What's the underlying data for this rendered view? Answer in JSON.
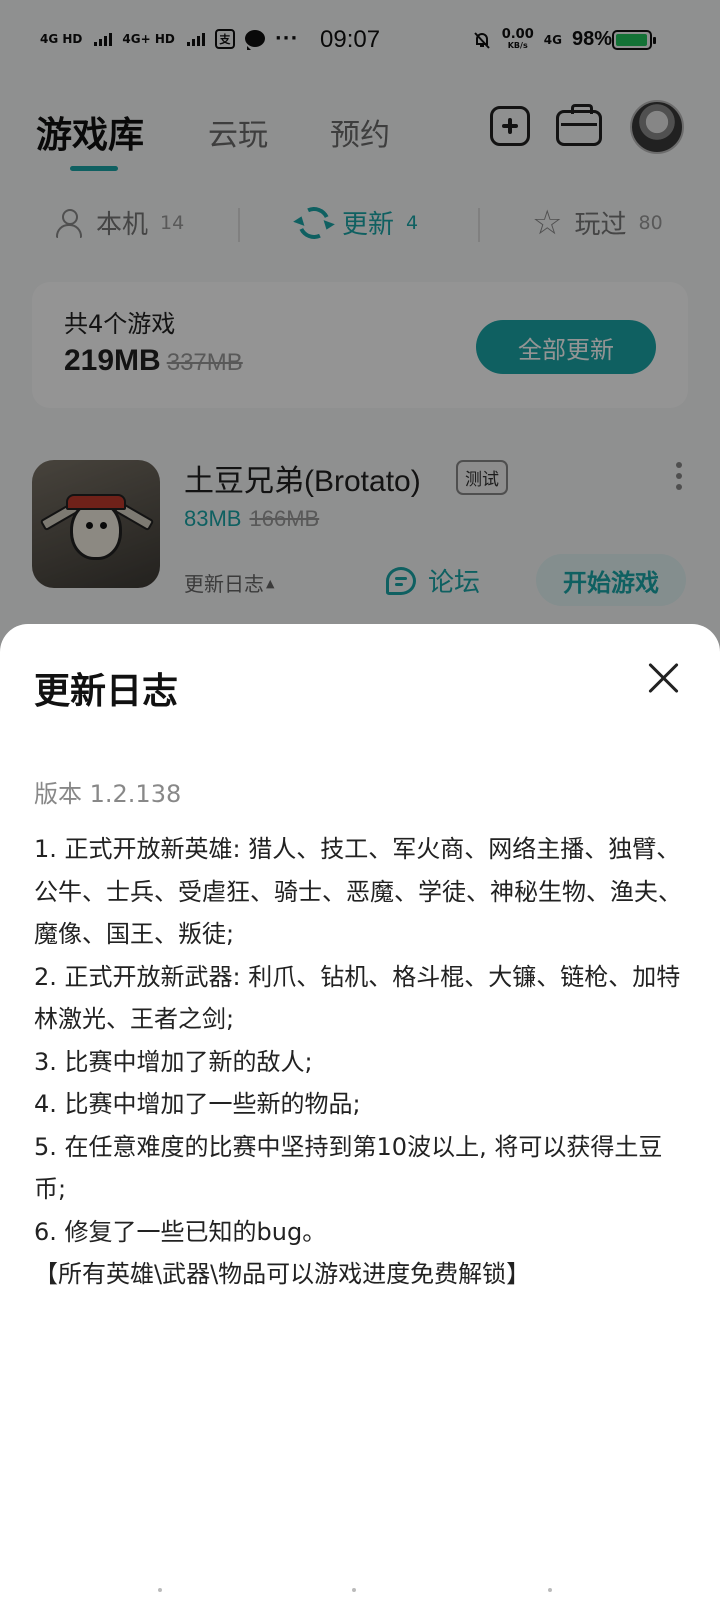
{
  "status_bar": {
    "network_left_1": "4G HD",
    "network_left_2": "4G+ HD",
    "alipay_glyph": "支",
    "more_glyph": "···",
    "time": "09:07",
    "speed_value": "0.00",
    "speed_unit": "KB/s",
    "network_right": "4G",
    "battery_percent": "98%",
    "battery_level": 0.98,
    "battery_color": "#22c55e"
  },
  "header": {
    "tabs": [
      {
        "label": "游戏库",
        "active": true
      },
      {
        "label": "云玩",
        "active": false
      },
      {
        "label": "预约",
        "active": false
      }
    ],
    "accent_color": "#1aa5a8"
  },
  "filters": [
    {
      "label": "本机",
      "count": "14",
      "icon": "device-user-icon",
      "active": false
    },
    {
      "label": "更新",
      "count": "4",
      "icon": "refresh-icon",
      "active": true
    },
    {
      "label": "玩过",
      "count": "80",
      "icon": "star-icon",
      "active": false
    }
  ],
  "summary": {
    "title": "共4个游戏",
    "size": "219MB",
    "old_size": "337MB",
    "update_all_label": "全部更新"
  },
  "game": {
    "title": "土豆兄弟(Brotato)",
    "badge": "测试",
    "size": "83MB",
    "old_size": "166MB",
    "changelog_label": "更新日志",
    "forum_label": "论坛",
    "play_label": "开始游戏"
  },
  "sheet": {
    "title": "更新日志",
    "version": "版本 1.2.138",
    "notes": [
      "1. 正式开放新英雄: 猎人、技工、军火商、网络主播、独臂、公牛、士兵、受虐狂、骑士、恶魔、学徒、神秘生物、渔夫、魔像、国王、叛徒;",
      "2. 正式开放新武器: 利爪、钻机、格斗棍、大镰、链枪、加特林激光、王者之剑;",
      "3. 比赛中增加了新的敌人;",
      "4. 比赛中增加了一些新的物品;",
      "5. 在任意难度的比赛中坚持到第10波以上, 将可以获得土豆币;",
      "6. 修复了一些已知的bug。",
      "【所有英雄\\武器\\物品可以游戏进度免费解锁】"
    ]
  }
}
